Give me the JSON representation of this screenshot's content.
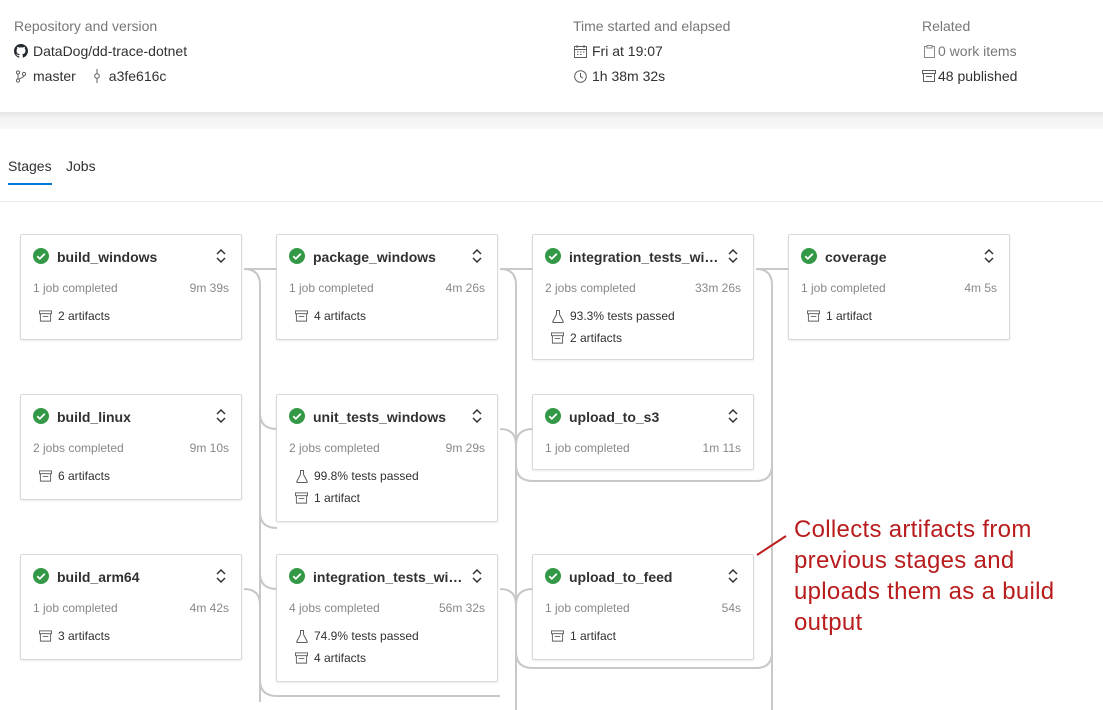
{
  "header": {
    "repo_label": "Repository and version",
    "repo_name": "DataDog/dd-trace-dotnet",
    "branch": "master",
    "commit": "a3fe616c",
    "time_label": "Time started and elapsed",
    "started": "Fri at 19:07",
    "elapsed": "1h 38m 32s",
    "related_label": "Related",
    "work_items": "0 work items",
    "published": "48 published"
  },
  "tabs": {
    "stages": "Stages",
    "jobs": "Jobs"
  },
  "stages": [
    {
      "name": "build_windows",
      "status": "1 job completed",
      "time": "9m 39s",
      "artifacts": "2 artifacts"
    },
    {
      "name": "build_linux",
      "status": "2 jobs completed",
      "time": "9m 10s",
      "artifacts": "6 artifacts"
    },
    {
      "name": "build_arm64",
      "status": "1 job completed",
      "time": "4m 42s",
      "artifacts": "3 artifacts"
    },
    {
      "name": "package_windows",
      "status": "1 job completed",
      "time": "4m 26s",
      "artifacts": "4 artifacts"
    },
    {
      "name": "unit_tests_windows",
      "status": "2 jobs completed",
      "time": "9m 29s",
      "tests": "99.8% tests passed",
      "artifacts": "1 artifact"
    },
    {
      "name": "integration_tests_win...",
      "status": "4 jobs completed",
      "time": "56m 32s",
      "tests": "74.9% tests passed",
      "artifacts": "4 artifacts"
    },
    {
      "name": "integration_tests_win...",
      "status": "2 jobs completed",
      "time": "33m 26s",
      "tests": "93.3% tests passed",
      "artifacts": "2 artifacts"
    },
    {
      "name": "upload_to_s3",
      "status": "1 job completed",
      "time": "1m 11s"
    },
    {
      "name": "upload_to_feed",
      "status": "1 job completed",
      "time": "54s",
      "artifacts": "1 artifact"
    },
    {
      "name": "coverage",
      "status": "1 job completed",
      "time": "4m 5s",
      "artifacts": "1 artifact"
    }
  ],
  "annotation": "Collects artifacts from previous stages and uploads them as a build output",
  "colors": {
    "success": "#339947",
    "accent": "#0078d4",
    "annotation": "#b91c1c",
    "connector": "#c8c8c8"
  }
}
